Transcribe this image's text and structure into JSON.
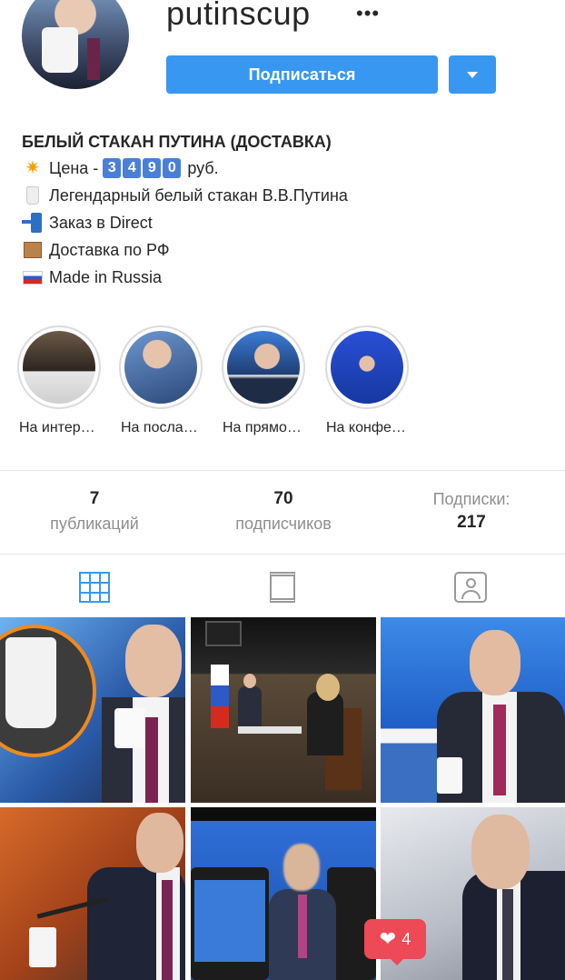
{
  "profile": {
    "username": "putinscup",
    "more_icon": "more-horizontal-icon",
    "follow_label": "Подписаться",
    "dropdown_icon": "chevron-down-icon",
    "accent_color": "#3897f0"
  },
  "bio": {
    "name": "БЕЛЫЙ СТАКАН ПУТИНА (ДОСТАВКА)",
    "price_prefix": "Цена -",
    "price_digits": [
      "3",
      "4",
      "9",
      "0"
    ],
    "price_suffix": "руб.",
    "line_cup": "Легендарный белый стакан В.В.Путина",
    "line_order": "Заказ в Direct",
    "line_delivery": "Доставка по РФ",
    "line_made": "Made in Russia"
  },
  "highlights": [
    {
      "label": "На интер…"
    },
    {
      "label": "На посла…"
    },
    {
      "label": "На прямо…"
    },
    {
      "label": "На конфе…"
    }
  ],
  "stats": {
    "posts_count": "7",
    "posts_label": "публикаций",
    "followers_count": "70",
    "followers_label": "подписчиков",
    "following_label": "Подписки:",
    "following_count": "217"
  },
  "tabs": [
    {
      "name": "grid",
      "icon": "grid-icon",
      "active": true
    },
    {
      "name": "feed",
      "icon": "feed-icon",
      "active": false
    },
    {
      "name": "tagged",
      "icon": "tagged-icon",
      "active": false
    }
  ],
  "like_notification": {
    "icon": "heart-icon",
    "count": "4",
    "color": "#ed4956"
  }
}
